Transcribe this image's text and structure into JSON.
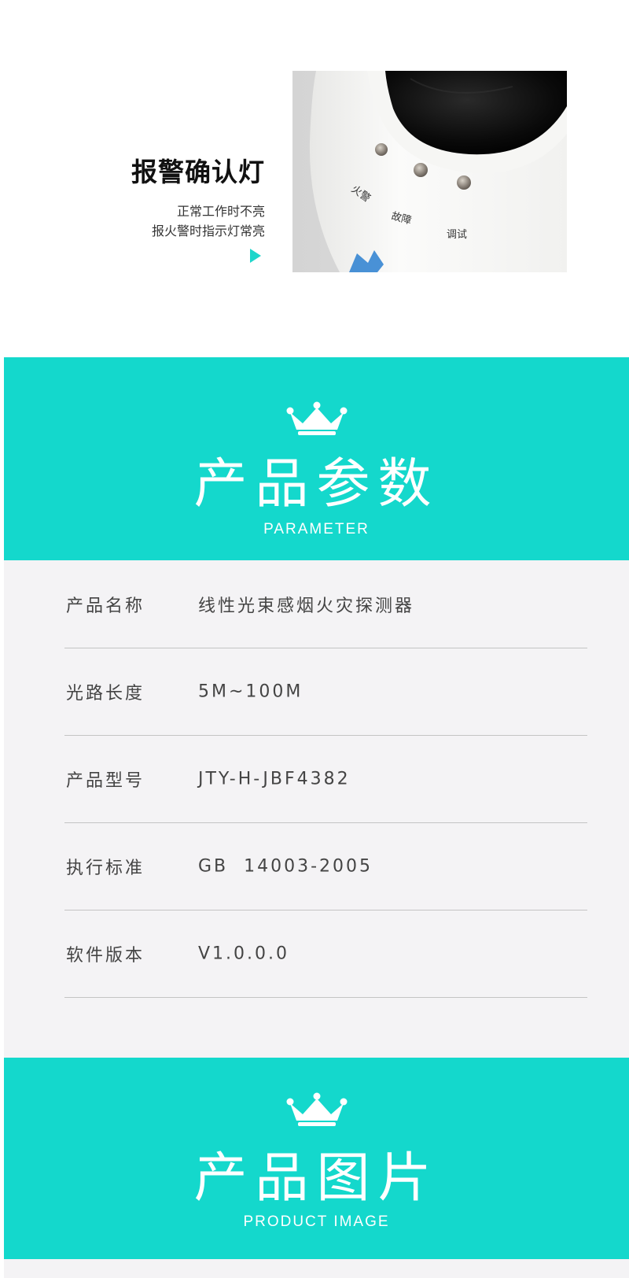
{
  "feature": {
    "title": "报警确认灯",
    "desc_line1": "正常工作时不亮",
    "desc_line2": "报火警时指示灯常亮",
    "photo_labels": {
      "fire": "火警",
      "fault": "故障",
      "test": "调试"
    }
  },
  "parameter_section": {
    "title": "产品参数",
    "subtitle": "PARAMETER",
    "icon": "crown-icon"
  },
  "parameters": [
    {
      "label": "产品名称",
      "value": "线性光束感烟火灾探测器"
    },
    {
      "label": "光路长度",
      "value": "5M~100M"
    },
    {
      "label": "产品型号",
      "value": "JTY-H-JBF4382"
    },
    {
      "label": "执行标准",
      "value": "GB  14003-2005"
    },
    {
      "label": "软件版本",
      "value": "V1.0.0.0"
    }
  ],
  "image_section": {
    "title": "产品图片",
    "subtitle": "PRODUCT IMAGE",
    "icon": "crown-icon"
  },
  "colors": {
    "accent": "#14d8cc",
    "panel": "#f4f3f5"
  }
}
